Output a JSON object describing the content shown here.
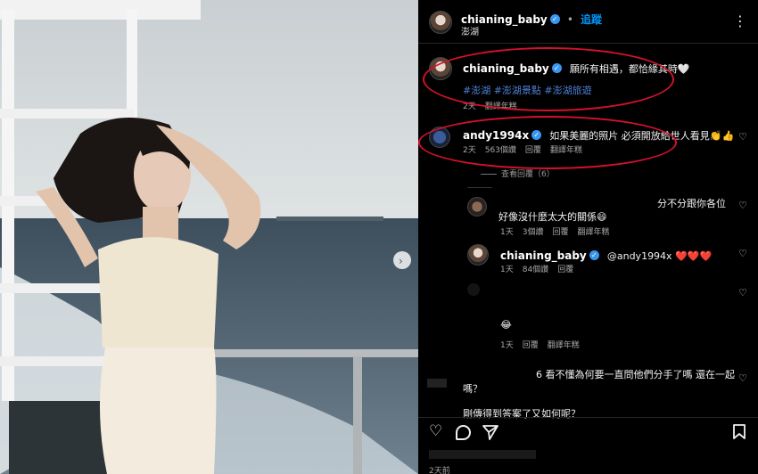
{
  "header": {
    "username": "chianing_baby",
    "follow_label": "追蹤",
    "location": "澎湖",
    "more_icon": "more-vertical-icon"
  },
  "caption": {
    "username": "chianing_baby",
    "text": "願所有相遇，都恰緣其時🤍",
    "hashtags": "#澎湖 #澎湖景點 #澎湖旅遊",
    "time": "2天",
    "translate": "翻譯年糕"
  },
  "comments": [
    {
      "username": "andy1994x",
      "text": "如果美麗的照片 必須開放給世人看見👏👍",
      "time": "2天",
      "likes": "563個讚",
      "reply": "回覆",
      "translate": "翻譯年糕",
      "view_replies": "查看回覆（6）"
    }
  ],
  "replies": [
    {
      "text_line1": "分不分跟你各位",
      "text_line2": "好像沒什麼太大的關係😄",
      "time": "1天",
      "likes": "3個讚",
      "reply": "回覆",
      "translate": "翻譯年糕"
    },
    {
      "username": "chianing_baby",
      "text": "@andy1994x ❤️❤️❤️",
      "time": "1天",
      "likes": "84個讚",
      "reply": "回覆"
    },
    {
      "text": "😂",
      "time": "1天",
      "reply": "回覆",
      "translate": "翻譯年糕"
    },
    {
      "text_line1": "6 看不懂為何要一直問他們分手了嗎 還在一起",
      "text_line2": "嗎？",
      "text_line3": "剛傳得到答案了又如何呢？"
    }
  ],
  "actions": {
    "like_icon": "heart-icon",
    "comment_icon": "comment-icon",
    "share_icon": "send-icon",
    "save_icon": "bookmark-icon"
  },
  "footer_time": "2天前",
  "colors": {
    "verified": "#3897f0",
    "hashtag": "#4f7fd6",
    "highlight_ring": "#d3122a"
  }
}
